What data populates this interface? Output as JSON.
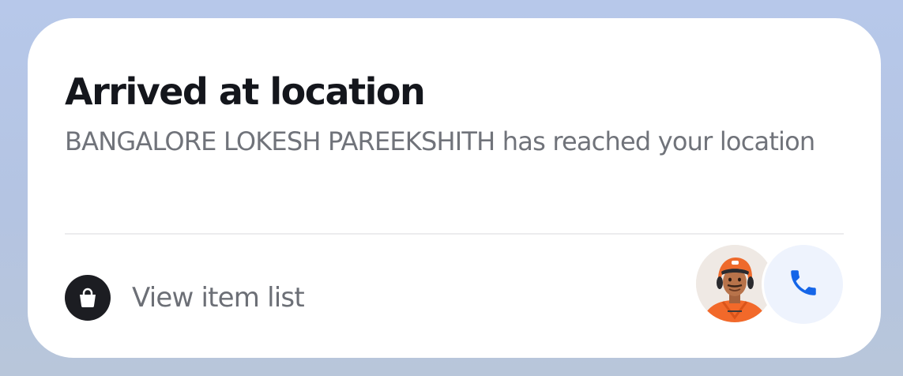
{
  "notification": {
    "title": "Arrived at location",
    "message": "BANGALORE LOKESH PAREEKSHITH has reached your location",
    "item_list_label": "View item list",
    "icons": {
      "item_list": "shopping-bag-icon",
      "call": "phone-icon"
    },
    "colors": {
      "call_icon": "#1565e8",
      "call_background": "#eef3fd",
      "rider_uniform": "#f2692a"
    }
  }
}
